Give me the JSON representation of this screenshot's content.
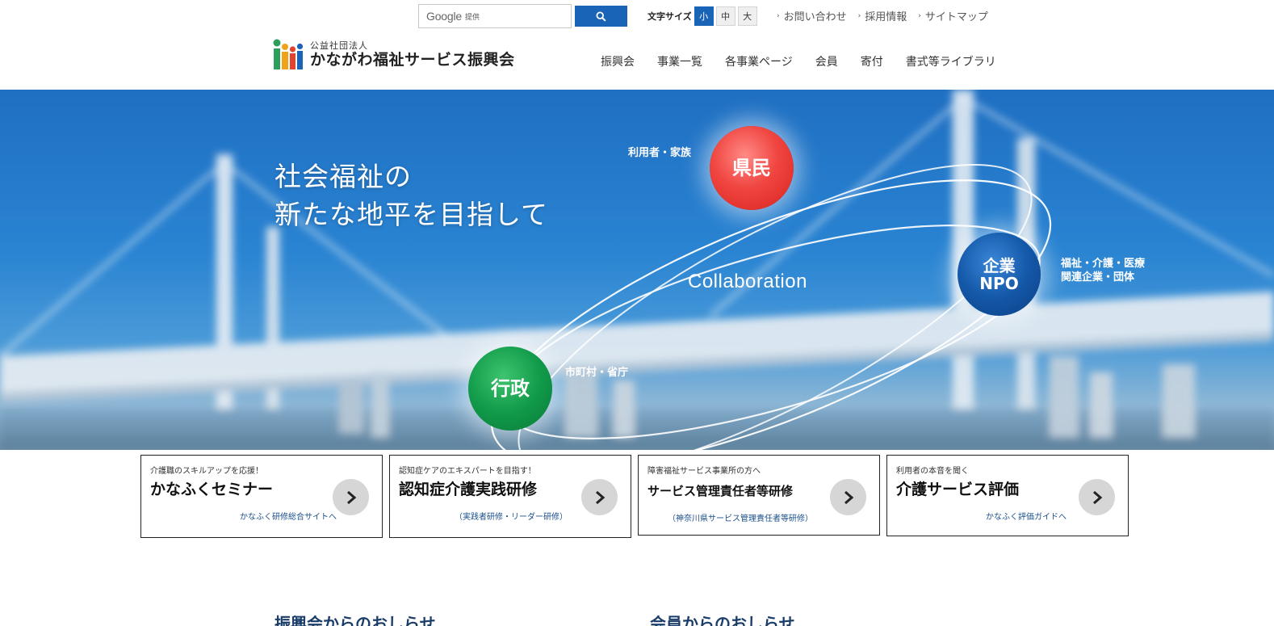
{
  "header": {
    "search": {
      "logo": "Google",
      "provided": "提供"
    },
    "font_size": {
      "label": "文字サイズ",
      "options": [
        "小",
        "中",
        "大"
      ],
      "selected": "小"
    },
    "util_links": [
      "お問い合わせ",
      "採用情報",
      "サイトマップ"
    ],
    "brand": {
      "sub": "公益社団法人",
      "name": "かながわ福祉サービス振興会"
    },
    "nav": [
      "振興会",
      "事業一覧",
      "各事業ページ",
      "会員",
      "寄付",
      "書式等ライブラリ"
    ]
  },
  "hero": {
    "title_line1": "社会福祉の",
    "title_line2": "新たな地平を目指して",
    "collaboration": "Collaboration",
    "kenmin": {
      "text": "県民",
      "label": "利用者・家族"
    },
    "kigyo": {
      "line1": "企業",
      "line2": "NPO",
      "label_line1": "福祉・介護・医療",
      "label_line2": "関連企業・団体"
    },
    "gyosei": {
      "text": "行政",
      "label": "市町村・省庁"
    }
  },
  "cards": [
    {
      "lead": "介護職のスキルアップを応援！",
      "title": "かなふくセミナー",
      "sub": "かなふく研修総合サイトへ"
    },
    {
      "lead": "認知症ケアのエキスパートを目指す！",
      "title": "認知症介護実践研修",
      "sub": "（実践者研修・リーダー研修）"
    },
    {
      "lead": "障害福祉サービス事業所の方へ",
      "title": "サービス管理責任者等研修",
      "sub": "（神奈川県サービス管理責任者等研修）"
    },
    {
      "lead": "利用者の本音を聞く",
      "title": "介護サービス評価",
      "sub": "かなふく評価ガイドへ"
    }
  ],
  "news": {
    "left": "振興会からのおしらせ",
    "right": "会員からのおしらせ"
  },
  "colors": {
    "accent_blue": "#1a64b8",
    "kenmin_red": "#f04540",
    "kigyo_blue": "#1458a8",
    "gyosei_green": "#119b4a"
  }
}
